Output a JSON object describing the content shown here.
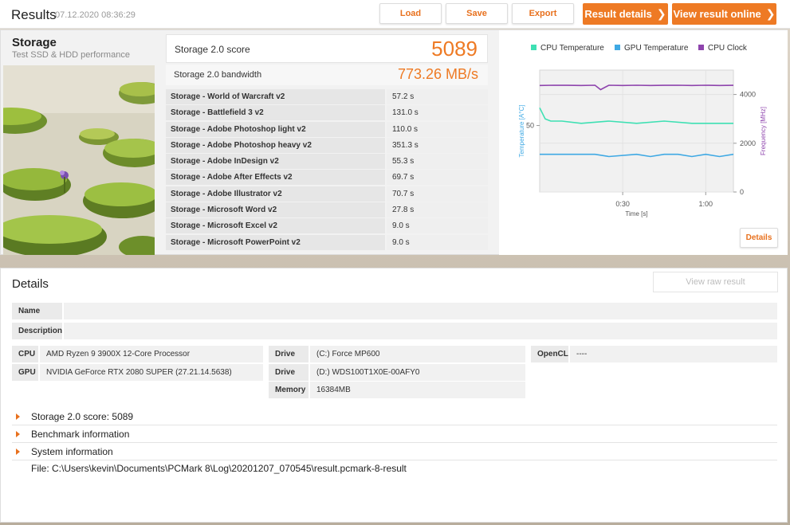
{
  "header": {
    "title": "Results",
    "date": "07.12.2020 08:36:29",
    "buttons": {
      "load": "Load",
      "save": "Save",
      "export": "Export",
      "result_details": "Result details",
      "view_online": "View result online"
    },
    "chevron_glyph": "❯"
  },
  "benchmark": {
    "name": "Storage",
    "subtitle": "Test SSD & HDD performance",
    "score_label": "Storage 2.0 score",
    "score_value": "5089",
    "bandwidth_label": "Storage 2.0 bandwidth",
    "bandwidth_value": "773.26 MB/s",
    "tests": [
      {
        "name": "Storage - World of Warcraft v2",
        "value": "57.2 s"
      },
      {
        "name": "Storage - Battlefield 3 v2",
        "value": "131.0 s"
      },
      {
        "name": "Storage - Adobe Photoshop light v2",
        "value": "110.0 s"
      },
      {
        "name": "Storage - Adobe Photoshop heavy v2",
        "value": "351.3 s"
      },
      {
        "name": "Storage - Adobe InDesign v2",
        "value": "55.3 s"
      },
      {
        "name": "Storage - Adobe After Effects v2",
        "value": "69.7 s"
      },
      {
        "name": "Storage - Adobe Illustrator v2",
        "value": "70.7 s"
      },
      {
        "name": "Storage - Microsoft Word v2",
        "value": "27.8 s"
      },
      {
        "name": "Storage - Microsoft Excel v2",
        "value": "9.0 s"
      },
      {
        "name": "Storage - Microsoft PowerPoint v2",
        "value": "9.0 s"
      }
    ]
  },
  "monitoring": {
    "details_button": "Details",
    "chart_data": {
      "type": "line",
      "series": [
        {
          "name": "CPU Temperature",
          "color": "#3ee0b3",
          "axis": "left",
          "x": [
            0,
            2,
            4,
            8,
            15,
            25,
            35,
            45,
            55,
            60,
            70
          ],
          "values": [
            58,
            53,
            52,
            52,
            51,
            52,
            51,
            52,
            51,
            51,
            51
          ]
        },
        {
          "name": "GPU Temperature",
          "color": "#3fa9e4",
          "axis": "left",
          "x": [
            0,
            10,
            20,
            25,
            35,
            40,
            45,
            50,
            55,
            60,
            65,
            70
          ],
          "values": [
            37,
            37,
            37,
            36,
            37,
            36,
            37,
            37,
            36,
            37,
            36,
            37
          ]
        },
        {
          "name": "CPU Clock",
          "color": "#8e44ad",
          "axis": "right",
          "x": [
            0,
            5,
            10,
            15,
            20,
            22,
            25,
            30,
            35,
            40,
            45,
            50,
            55,
            60,
            65,
            70
          ],
          "values": [
            4370,
            4380,
            4375,
            4370,
            4380,
            4200,
            4380,
            4370,
            4380,
            4370,
            4375,
            4380,
            4370,
            4380,
            4370,
            4375
          ]
        }
      ],
      "xlabel": "Time [s]",
      "ylabel_left": "Temperature [A°C]",
      "ylabel_right": "Frequency [MHz]",
      "x_ticks": [
        {
          "v": 30,
          "label": "0:30"
        },
        {
          "v": 60,
          "label": "1:00"
        }
      ],
      "y_left_ticks": [
        {
          "v": 50,
          "label": "50"
        }
      ],
      "y_right_ticks": [
        {
          "v": 4000,
          "label": "4000"
        },
        {
          "v": 2000,
          "label": "2000"
        },
        {
          "v": 0,
          "label": "0"
        }
      ],
      "xlim": [
        0,
        70
      ],
      "ylim_left": [
        20,
        75
      ],
      "ylim_right": [
        0,
        5000
      ],
      "legend_position": "top",
      "grid": true
    }
  },
  "details": {
    "title": "Details",
    "view_raw": "View raw result",
    "name_label": "Name",
    "name_value": "",
    "description_label": "Description",
    "description_value": "",
    "cpu_label": "CPU",
    "cpu_value": "AMD Ryzen 9 3900X 12-Core Processor",
    "gpu_label": "GPU",
    "gpu_value": "NVIDIA GeForce RTX 2080 SUPER (27.21.14.5638)",
    "drive1_label": "Drive",
    "drive1_value": "(C:) Force MP600",
    "drive2_label": "Drive",
    "drive2_value": "(D:) WDS100T1X0E-00AFY0",
    "memory_label": "Memory",
    "memory_value": "16384MB",
    "opencl_label": "OpenCL",
    "opencl_value": "----",
    "sections": [
      {
        "label": "Storage 2.0 score: 5089"
      },
      {
        "label": "Benchmark information"
      },
      {
        "label": "System information"
      }
    ],
    "file_path": "File: C:\\Users\\kevin\\Documents\\PCMark 8\\Log\\20201207_070545\\result.pcmark-8-result"
  }
}
